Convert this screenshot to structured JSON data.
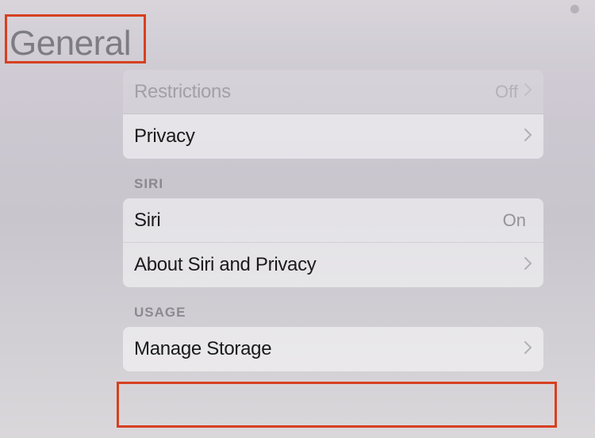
{
  "header": {
    "title": "General"
  },
  "sections": {
    "first": {
      "restrictions": {
        "label": "Restrictions",
        "value": "Off"
      },
      "privacy": {
        "label": "Privacy"
      }
    },
    "siri": {
      "header": "SIRI",
      "siri": {
        "label": "Siri",
        "value": "On"
      },
      "about": {
        "label": "About Siri and Privacy"
      }
    },
    "usage": {
      "header": "USAGE",
      "storage": {
        "label": "Manage Storage"
      }
    }
  }
}
